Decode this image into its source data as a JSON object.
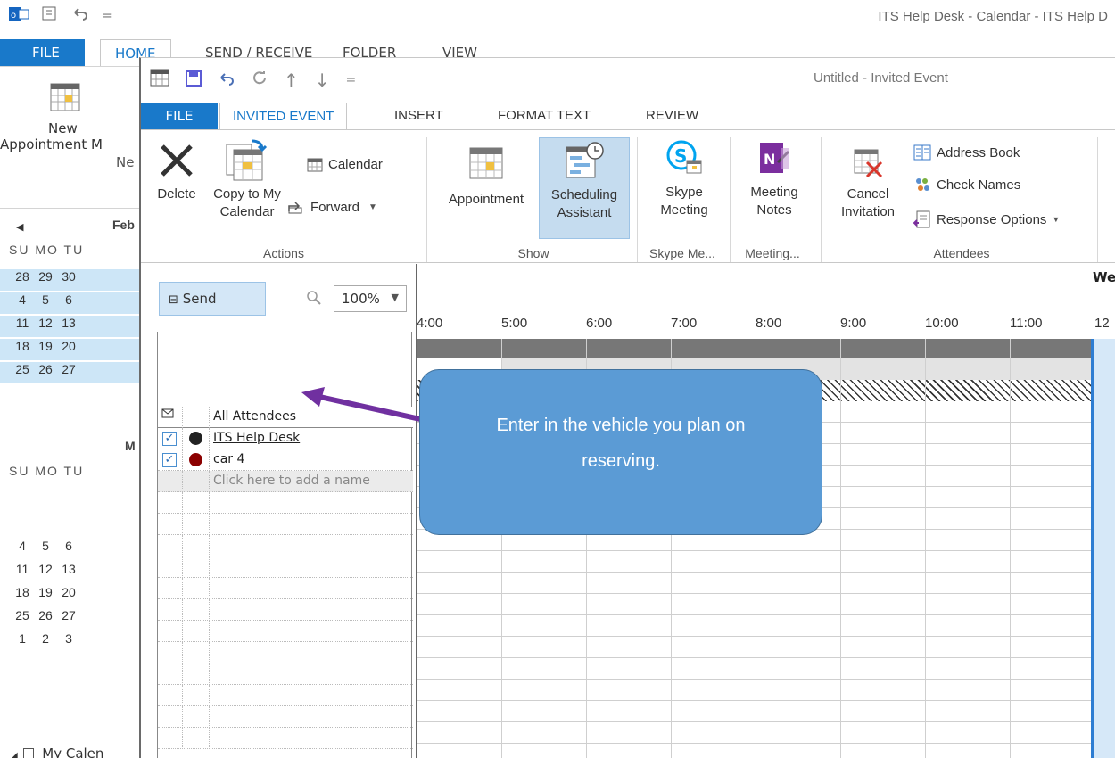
{
  "background_window": {
    "title": "ITS Help Desk - Calendar - ITS Help D",
    "tabs": {
      "file": "FILE",
      "home": "HOME",
      "send_receive": "SEND / RECEIVE",
      "folder": "FOLDER",
      "view": "VIEW"
    },
    "new_appointment_line1": "New",
    "new_appointment_line2": "Appointment M",
    "group_new": "Ne",
    "feb_header": "Feb",
    "mar_header": "M",
    "dow": "SU MO TU",
    "feb_rows": [
      [
        "28",
        "29",
        "30"
      ],
      [
        "4",
        "5",
        "6"
      ],
      [
        "11",
        "12",
        "13"
      ],
      [
        "18",
        "19",
        "20"
      ],
      [
        "25",
        "26",
        "27"
      ]
    ],
    "mar_rows": [
      [
        "4",
        "5",
        "6"
      ],
      [
        "11",
        "12",
        "13"
      ],
      [
        "18",
        "19",
        "20"
      ],
      [
        "25",
        "26",
        "27"
      ],
      [
        "1",
        "2",
        "3"
      ]
    ],
    "my_calendars": "My Calen"
  },
  "window": {
    "caption": "Untitled - Invited Event",
    "tabs": {
      "file": "FILE",
      "invited_event": "INVITED EVENT",
      "insert": "INSERT",
      "format_text": "FORMAT TEXT",
      "review": "REVIEW"
    }
  },
  "ribbon": {
    "delete": "Delete",
    "copy_line1": "Copy to My",
    "copy_line2": "Calendar",
    "calendar": "Calendar",
    "forward": "Forward",
    "actions_group": "Actions",
    "appointment": "Appointment",
    "scheduling_line1": "Scheduling",
    "scheduling_line2": "Assistant",
    "show_group": "Show",
    "skype_line1": "Skype",
    "skype_line2": "Meeting",
    "skype_group": "Skype Me...",
    "notes_line1": "Meeting",
    "notes_line2": "Notes",
    "meeting_group": "Meeting...",
    "cancel_line1": "Cancel",
    "cancel_line2": "Invitation",
    "address_book": "Address Book",
    "check_names": "Check Names",
    "response_options": "Response Options",
    "attendees_group": "Attendees"
  },
  "scheduling": {
    "send": "Send",
    "zoom": "100%",
    "all_attendees": "All Attendees",
    "attendees": [
      {
        "name": "ITS Help Desk",
        "status_color": "#222222"
      },
      {
        "name": "car 4",
        "status_color": "#8b0000"
      }
    ],
    "add_name_placeholder": "Click here to add a name",
    "times": [
      "4:00",
      "5:00",
      "6:00",
      "7:00",
      "8:00",
      "9:00",
      "10:00",
      "11:00",
      "12"
    ],
    "day_label": "We"
  },
  "callout": {
    "line1": "Enter in the vehicle you plan on",
    "line2": "reserving."
  },
  "colors": {
    "accent": "#1979ca",
    "callout_fill": "#5b9bd5",
    "arrow": "#7030a0"
  }
}
